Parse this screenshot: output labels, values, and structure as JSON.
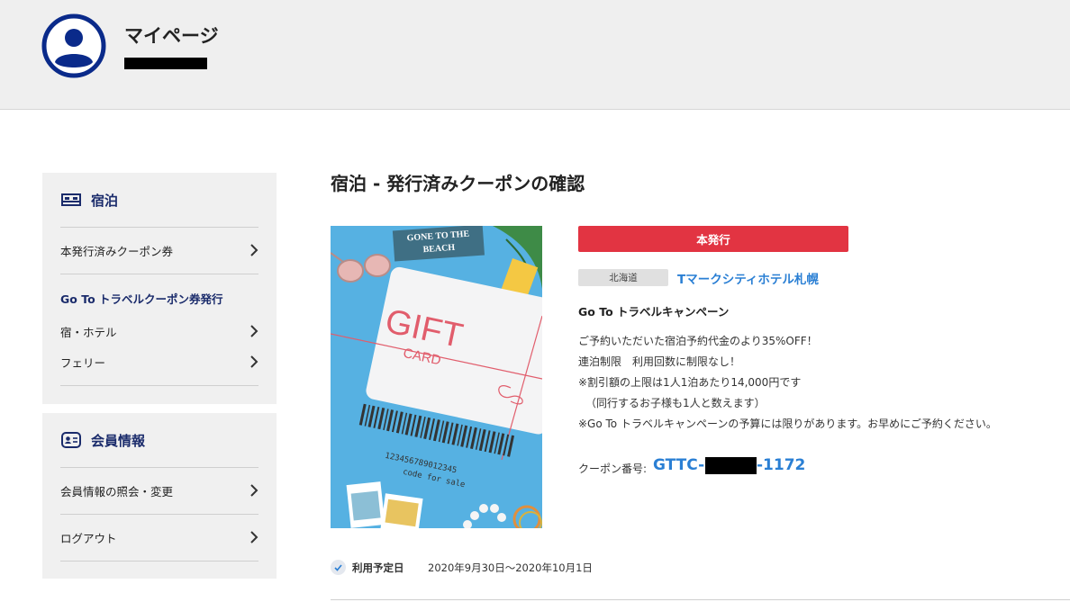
{
  "header": {
    "title": "マイページ"
  },
  "sidebar": {
    "stay": {
      "heading": "宿泊",
      "items": [
        {
          "label": "本発行済みクーポン券"
        }
      ],
      "sub_heading": "Go To トラベルクーポン券発行",
      "sub_items": [
        {
          "label": "宿・ホテル"
        },
        {
          "label": "フェリー"
        }
      ]
    },
    "member": {
      "heading": "会員情報",
      "items": [
        {
          "label": "会員情報の照会・変更"
        },
        {
          "label": "ログアウト"
        }
      ]
    }
  },
  "main": {
    "title": "宿泊 - 発行済みクーポンの確認",
    "image": {
      "sign_line1": "GONE TO THE",
      "sign_line2": "BEACH",
      "card_title": "GIFT",
      "card_subtitle": "CARD",
      "card_number": "123456789012345",
      "card_note": "code for sale"
    },
    "status_badge": "本発行",
    "region": "北海道",
    "hotel_name": "Tマークシティホテル札幌",
    "campaign_title": "Go To トラベルキャンペーン",
    "description": [
      "ご予約いただいた宿泊予約代金のより35%OFF！",
      "連泊制限　利用回数に制限なし！",
      "※割引額の上限は1人1泊あたり14,000円です",
      "（同行するお子様も1人と数えます）",
      "※Go To トラベルキャンペーンの予算には限りがあります。お早めにご予約ください。"
    ],
    "coupon": {
      "label": "クーポン番号:",
      "prefix": "GTTC-",
      "suffix": "-1172"
    },
    "usage": {
      "label": "利用予定日",
      "value": "2020年9月30日～2020年10月1日"
    }
  },
  "colors": {
    "brand_navy": "#1a2b6b",
    "accent_blue": "#2a7fd4",
    "badge_red": "#e23442",
    "header_bg": "#efefef",
    "sidebar_bg": "#f0f0f0"
  },
  "icons": {
    "avatar": "user-circle-icon",
    "stay": "bed-icon",
    "member": "id-card-icon",
    "chevron": "chevron-right-icon",
    "check": "check-icon"
  }
}
